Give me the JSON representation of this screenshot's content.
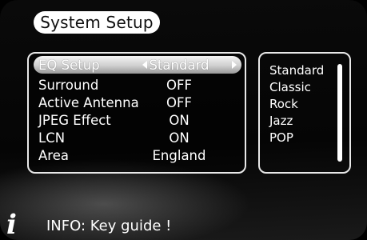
{
  "header": {
    "title": "System Setup"
  },
  "menu": {
    "rows": [
      {
        "label": "EQ Setup",
        "value": "Standard",
        "selected": true
      },
      {
        "label": "Surround",
        "value": "OFF"
      },
      {
        "label": "Active Antenna",
        "value": "OFF"
      },
      {
        "label": "JPEG Effect",
        "value": "ON"
      },
      {
        "label": "LCN",
        "value": "ON"
      },
      {
        "label": "Area",
        "value": "England"
      }
    ]
  },
  "options": {
    "items": [
      "Standard",
      "Classic",
      "Rock",
      "Jazz",
      "POP"
    ]
  },
  "footer": {
    "info_text": "INFO: Key guide !"
  },
  "colors": {
    "panel_border": "#e8e8e8",
    "highlight": "#cfcfcf",
    "background": "#000000"
  }
}
